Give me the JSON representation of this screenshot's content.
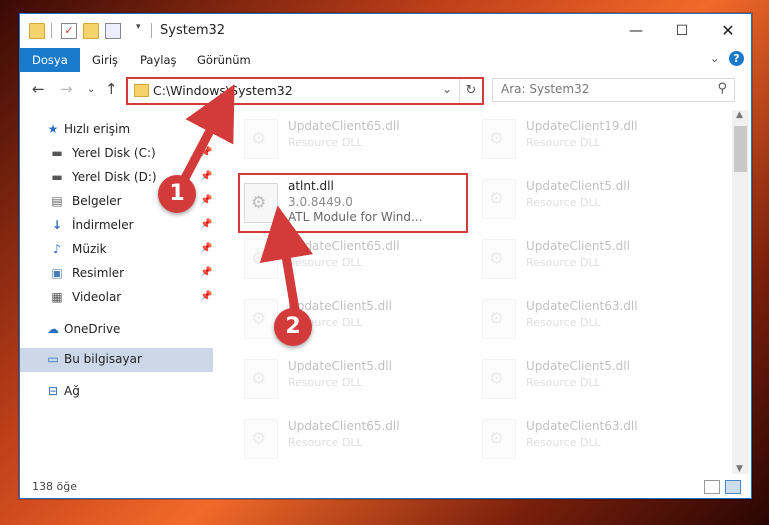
{
  "window": {
    "title": "System32"
  },
  "ribbon": {
    "tabs": [
      "Dosya",
      "Giriş",
      "Paylaş",
      "Görünüm"
    ],
    "active_tab": "Dosya"
  },
  "address": {
    "path": "C:\\Windows\\System32",
    "search_placeholder": "Ara: System32"
  },
  "sidebar": {
    "items": [
      {
        "label": "Hızlı erişim",
        "icon": "star-icon",
        "pinned": false
      },
      {
        "label": "Yerel Disk (C:)",
        "icon": "drive-icon",
        "pinned": true
      },
      {
        "label": "Yerel Disk (D:)",
        "icon": "drive-icon",
        "pinned": true
      },
      {
        "label": "Belgeler",
        "icon": "documents-icon",
        "pinned": true
      },
      {
        "label": "İndirmeler",
        "icon": "download-icon",
        "pinned": true
      },
      {
        "label": "Müzik",
        "icon": "music-icon",
        "pinned": true
      },
      {
        "label": "Resimler",
        "icon": "pictures-icon",
        "pinned": true
      },
      {
        "label": "Videolar",
        "icon": "videos-icon",
        "pinned": true
      },
      {
        "label": "OneDrive",
        "icon": "cloud-icon",
        "pinned": false
      },
      {
        "label": "Bu bilgisayar",
        "icon": "computer-icon",
        "pinned": false,
        "selected": true
      },
      {
        "label": "Ağ",
        "icon": "network-icon",
        "pinned": false
      }
    ]
  },
  "files": [
    {
      "name": "UpdateClient65.dll",
      "type": "Resource DLL",
      "faded": true
    },
    {
      "name": "UpdateClient19.dll",
      "type": "Resource DLL",
      "faded": true
    },
    {
      "name": "atlnt.dll",
      "version": "3.0.8449.0",
      "description": "ATL Module for Wind...",
      "highlighted": true
    },
    {
      "name": "UpdateClient5.dll",
      "type": "Resource DLL",
      "faded": true
    },
    {
      "name": "UpdateClient65.dll",
      "type": "Resource DLL",
      "faded": true
    },
    {
      "name": "UpdateClient5.dll",
      "type": "Resource DLL",
      "faded": true
    },
    {
      "name": "UpdateClient5.dll",
      "type": "Resource DLL",
      "faded": true
    },
    {
      "name": "UpdateClient63.dll",
      "type": "Resource DLL",
      "faded": true
    },
    {
      "name": "UpdateClient5.dll",
      "type": "Resource DLL",
      "faded": true
    },
    {
      "name": "UpdateClient5.dll",
      "type": "Resource DLL",
      "faded": true
    },
    {
      "name": "UpdateClient65.dll",
      "type": "Resource DLL",
      "faded": true
    },
    {
      "name": "UpdateClient63.dll",
      "type": "Resource DLL",
      "faded": true
    }
  ],
  "status": {
    "item_count": "138 öğe"
  },
  "annotations": {
    "step1": "1",
    "step2": "2"
  },
  "colors": {
    "accent": "#1979ca",
    "highlight": "#d33a3a"
  }
}
